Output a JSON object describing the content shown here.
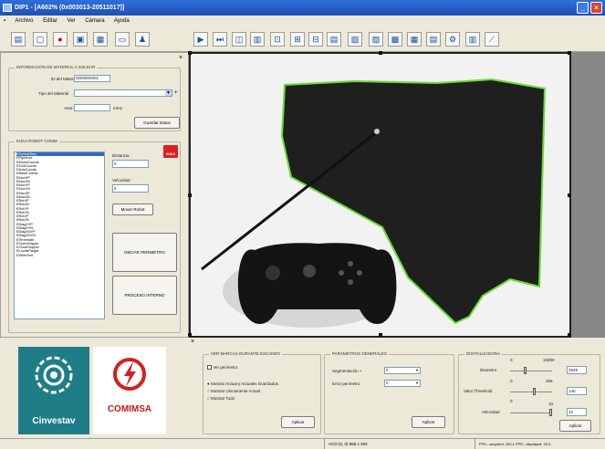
{
  "window": {
    "title": "DIP1 - [A602% (0x003013-20511017)]"
  },
  "menu": {
    "items": [
      "Archivo",
      "Editar",
      "Ver",
      "Cámara",
      "Ayuda"
    ]
  },
  "material": {
    "group_title": "INFORMACIÓN DE MATERIAL A SOLDAR",
    "id_label": "ID del Material",
    "id_value": "0000000001",
    "tipo_label": "Tipo del Material",
    "tipo_value": "",
    "area_label": "Area",
    "area_unit": "mm2",
    "area_value": "",
    "save_button": "Guardar Datos"
  },
  "kuka": {
    "group_title": "KUKA ROBOT COMM",
    "commands": [
      "EDefaultSeq",
      "EPtpMove",
      "EWorldCoords",
      "EToolCoords",
      "EAxisCoords",
      "EBaseCoords",
      "EMovXP",
      "EMovXN",
      "EMovYP",
      "EMovYN",
      "EMovZP",
      "EMovZN",
      "ERotXP",
      "ERotXN",
      "ERotYP",
      "ERotYN",
      "ERotZP",
      "ERotZN",
      "EDiagXYP",
      "EDiagXYN",
      "EDiagXNYP",
      "EDiagXNYN",
      "ETerminate",
      "EOpenGripper",
      "ECloseGripper",
      "ELocateTarget",
      "EWriteText"
    ],
    "distancia_label": "Distancia",
    "distancia_value": "0",
    "velocidad_label": "Velocidad",
    "velocidad_value": "0",
    "kuka_badge": "KUKA",
    "mover_button": "Mover Robot",
    "iniciar_button": "INICIAR PERIMETRO",
    "proceso_button": "PROCESO INTERNO"
  },
  "logos": {
    "cinvestav": "Cinvestav",
    "comimsa": "COMIMSA"
  },
  "marcas": {
    "group_title": "VER MARCAS DURANTE ESCANEO",
    "ver_perimetro": "Ver perimetro",
    "opt1": "Mostrar Actual y Actuales Guardados",
    "opt2": "Mostrar Únicamente Actual",
    "opt3": "Mostrar Todo",
    "aplicar": "Aplicar"
  },
  "parametros": {
    "group_title": "PARÁMETROS GENERALES",
    "seg_label": "Segmentación +",
    "seg_value": "0",
    "error_label": "Error perimetro",
    "error_value": "0",
    "aplicar": "Aplicar"
  },
  "digitalizadora": {
    "group_title": "DIGITALIZADORA",
    "diametro_label": "Diametro",
    "diametro_min": "0",
    "diametro_max": "10000",
    "diametro_value": "3549",
    "threshold_label": "Valor Threshold",
    "threshold_min": "0",
    "threshold_max": "255",
    "threshold_value": "140",
    "velocidad_label": "Velocidad",
    "velocidad_min": "0",
    "velocidad_max": "10",
    "velocidad_value": "10",
    "aplicar": "Aplicar"
  },
  "status": {
    "coords": "ACO (0, 0) 656 x 493",
    "fps": "FPS - acquired: 100.1 FPS - displayed: 32.4"
  }
}
